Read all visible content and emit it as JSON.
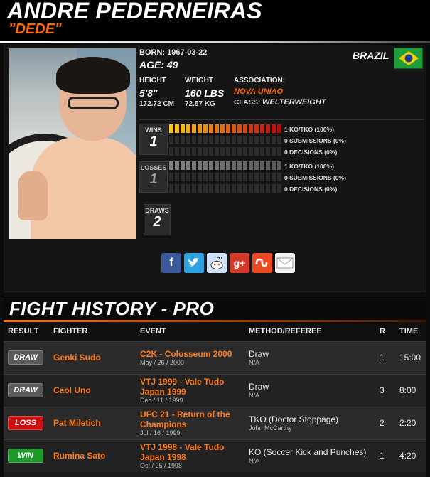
{
  "header": {
    "name": "ANDRE PEDERNEIRAS",
    "nickname": "\"DEDE\""
  },
  "profile": {
    "born_label": "BORN: 1967-03-22",
    "age_label": "AGE: 49",
    "height_label": "HEIGHT",
    "height_value": "5'8\"",
    "height_metric": "172.72 CM",
    "weight_label": "WEIGHT",
    "weight_value": "160 LBS",
    "weight_metric": "72.57 KG",
    "association_label": "ASSOCIATION:",
    "association_value": "NOVA UNIAO",
    "class_label": "CLASS:",
    "class_value": "WELTERWEIGHT",
    "country": "BRAZIL",
    "flag_colors": {
      "green": "#1f9d3a",
      "yellow": "#f4d000",
      "blue": "#1a3f9a"
    }
  },
  "record": {
    "wins": {
      "label": "WINS",
      "count": "1",
      "ko_fill": 1.0,
      "sub_fill": 0.0,
      "dec_fill": 0.0,
      "ko_text": "1 KO/TKO (100%)",
      "sub_text": "0 SUBMISSIONS (0%)",
      "dec_text": "0 DECISIONS (0%)",
      "color": "#d01c10"
    },
    "losses": {
      "label": "LOSSES",
      "count": "1",
      "ko_fill": 1.0,
      "sub_fill": 0.0,
      "dec_fill": 0.0,
      "ko_text": "1 KO/TKO (100%)",
      "sub_text": "0 SUBMISSIONS (0%)",
      "dec_text": "0 DECISIONS (0%)",
      "color": "#6d6d6d"
    },
    "draws": {
      "label": "DRAWS",
      "count": "2"
    }
  },
  "share_icons": [
    "facebook-icon",
    "twitter-icon",
    "reddit-icon",
    "google-plus-icon",
    "stumbleupon-icon",
    "email-icon"
  ],
  "fight_history": {
    "title": "FIGHT HISTORY - PRO",
    "columns": [
      "RESULT",
      "FIGHTER",
      "EVENT",
      "METHOD/REFEREE",
      "R",
      "TIME"
    ],
    "rows": [
      {
        "result": "DRAW",
        "result_color": "#5a5a5a",
        "fighter": "Genki Sudo",
        "event": "C2K - Colosseum 2000",
        "date": "May / 26 / 2000",
        "method": "Draw",
        "referee": "N/A",
        "round": "1",
        "time": "15:00"
      },
      {
        "result": "DRAW",
        "result_color": "#5a5a5a",
        "fighter": "Caol Uno",
        "event": "VTJ 1999 - Vale Tudo Japan 1999",
        "date": "Dec / 11 / 1999",
        "method": "Draw",
        "referee": "N/A",
        "round": "3",
        "time": "8:00"
      },
      {
        "result": "LOSS",
        "result_color": "#cc1010",
        "fighter": "Pat Miletich",
        "event": "UFC 21 - Return of the Champions",
        "date": "Jul / 16 / 1999",
        "method": "TKO (Doctor Stoppage)",
        "referee": "John McCarthy",
        "round": "2",
        "time": "2:20"
      },
      {
        "result": "WIN",
        "result_color": "#1f9a2a",
        "fighter": "Rumina Sato",
        "event": "VTJ 1998 - Vale Tudo Japan 1998",
        "date": "Oct / 25 / 1998",
        "method": "KO (Soccer Kick and Punches)",
        "referee": "N/A",
        "round": "1",
        "time": "4:20"
      }
    ]
  }
}
